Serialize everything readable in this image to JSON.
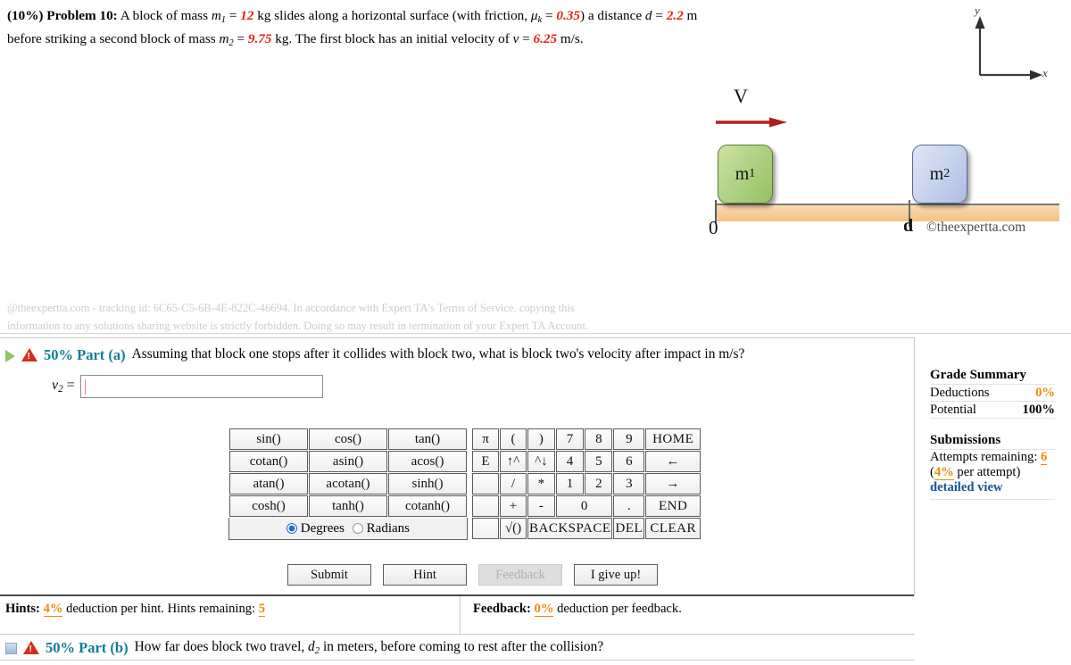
{
  "problem": {
    "weight": "(10%)",
    "title": "Problem 10:",
    "text_1": "A block of mass ",
    "m1_sym": "m",
    "m1_sub": "1",
    "eq1": " = ",
    "m1_val": "12",
    "text_2": " kg slides along a horizontal surface (with friction, ",
    "mu_sym": "μ",
    "mu_sub": "k",
    "eq2": " = ",
    "mu_val": "0.35",
    "text_3": ") a distance ",
    "d_sym": "d",
    "eq3": " = ",
    "d_val": "2.2",
    "text_4": " m before striking a second block of mass ",
    "m2_sym": "m",
    "m2_sub": "2",
    "eq4": " = ",
    "m2_val": "9.75",
    "text_5": " kg. The first block has an initial velocity of ",
    "v_sym": "v",
    "eq5": " = ",
    "v_val": "6.25",
    "text_6": " m/s."
  },
  "figure": {
    "velocity_label": "V",
    "block1_label": "m",
    "block1_sub": "1",
    "block2_label": "m",
    "block2_sub": "2",
    "origin_label": "0",
    "distance_label": "d",
    "credit": "©theexpertta.com",
    "axis_y": "y",
    "axis_x": "x",
    "colors": {
      "block1": "#96c162",
      "block2": "#aebde4",
      "ground": "#f7cb98",
      "arrow": "#b51d1d"
    }
  },
  "tracking": {
    "line1": "@theexpertta.com - tracking id: 6C65-C5-6B-4E-822C-46694. In accordance with Expert TA's Terms of Service. copying this",
    "line2": "information to any solutions sharing website is strictly forbidden. Doing so may result in termination of your Expert TA Account."
  },
  "part_a": {
    "percent": "50% Part (a)",
    "question": "Assuming that block one stops after it collides with block two, what is block two's velocity after impact in m/s?",
    "answer_label_var": "v",
    "answer_label_sub": "2",
    "answer_label_eq": "=",
    "answer_value": "",
    "expander_icon": "triangle-right-icon",
    "warning_icon": "warning-triangle-icon"
  },
  "part_b": {
    "percent": "50% Part (b)",
    "question_1": "How far does block two travel, ",
    "question_var": "d",
    "question_sub": "2",
    "question_2": " in meters, before coming to rest after the collision?",
    "expander_icon": "collapse-square-icon",
    "warning_icon": "warning-triangle-icon"
  },
  "keypad": {
    "functions": [
      [
        "sin()",
        "cos()",
        "tan()"
      ],
      [
        "cotan()",
        "asin()",
        "acos()"
      ],
      [
        "atan()",
        "acotan()",
        "sinh()"
      ],
      [
        "cosh()",
        "tanh()",
        "cotanh()"
      ]
    ],
    "mode": {
      "degrees_label": "Degrees",
      "radians_label": "Radians",
      "selected": "Degrees"
    },
    "rows": [
      {
        "keys": [
          {
            "label": "π",
            "enabled": true
          },
          {
            "label": "(",
            "enabled": true
          },
          {
            "label": ")",
            "enabled": false
          },
          {
            "label": "7",
            "enabled": true
          },
          {
            "label": "8",
            "enabled": true
          },
          {
            "label": "9",
            "enabled": true
          },
          {
            "label": "HOME",
            "enabled": false
          }
        ]
      },
      {
        "keys": [
          {
            "label": "E",
            "enabled": true
          },
          {
            "label": "↑^",
            "enabled": false
          },
          {
            "label": "^↓",
            "enabled": false
          },
          {
            "label": "4",
            "enabled": true
          },
          {
            "label": "5",
            "enabled": true
          },
          {
            "label": "6",
            "enabled": true
          },
          {
            "label": "←",
            "enabled": false
          }
        ]
      },
      {
        "keys": [
          {
            "label": "",
            "enabled": true
          },
          {
            "label": "/",
            "enabled": false
          },
          {
            "label": "*",
            "enabled": false
          },
          {
            "label": "1",
            "enabled": true
          },
          {
            "label": "2",
            "enabled": true
          },
          {
            "label": "3",
            "enabled": true
          },
          {
            "label": "→",
            "enabled": false
          }
        ]
      },
      {
        "keys": [
          {
            "label": "",
            "enabled": true
          },
          {
            "label": "+",
            "enabled": true
          },
          {
            "label": "-",
            "enabled": true
          },
          {
            "label": "0",
            "enabled": true
          },
          {
            "label": ".",
            "enabled": true
          },
          {
            "label": "END",
            "enabled": false
          }
        ]
      },
      {
        "keys": [
          {
            "label": "",
            "enabled": true
          },
          {
            "label": "√()",
            "enabled": true
          },
          {
            "label": "BACKSPACE",
            "enabled": false
          },
          {
            "label": "DEL",
            "enabled": false
          },
          {
            "label": "CLEAR",
            "enabled": false
          }
        ]
      }
    ]
  },
  "actions": {
    "submit": "Submit",
    "hint": "Hint",
    "feedback": "Feedback",
    "give_up": "I give up!"
  },
  "hints_bar": {
    "hints_label": "Hints:",
    "hints_pct": "4%",
    "hints_text": "deduction per hint. Hints remaining:",
    "hints_remaining": "5",
    "feedback_label": "Feedback:",
    "feedback_pct": "0%",
    "feedback_text": "deduction per feedback."
  },
  "grade_summary": {
    "title": "Grade Summary",
    "deductions_label": "Deductions",
    "deductions_value": "0%",
    "potential_label": "Potential",
    "potential_value": "100%",
    "submissions_title": "Submissions",
    "attempts_label": "Attempts remaining:",
    "attempts_value": "6",
    "per_attempt_open": "(",
    "per_attempt_pct": "4%",
    "per_attempt_text": " per attempt)",
    "detailed_view": "detailed view"
  }
}
